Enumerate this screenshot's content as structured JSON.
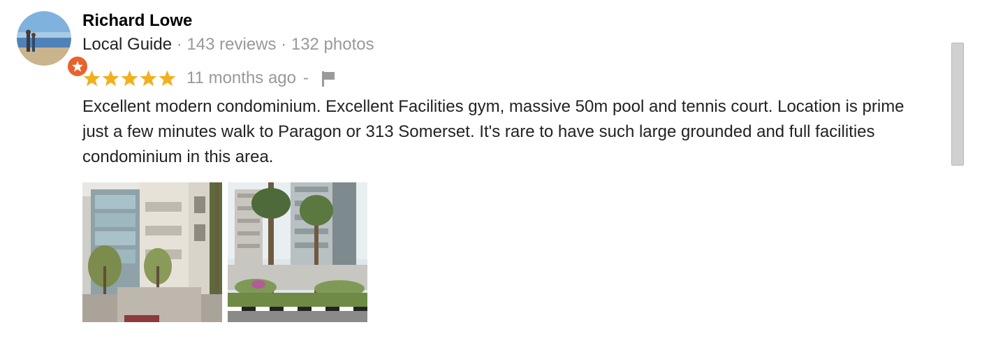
{
  "review": {
    "author": {
      "name": "Richard Lowe",
      "badge": "Local Guide",
      "separator": "·",
      "reviews_count": "143 reviews",
      "photos_count": "132 photos",
      "avatar_icon": "avatar-photo",
      "badge_icon": "local-guide-star-icon",
      "badge_color": "#e8622c"
    },
    "rating": 5,
    "max_rating": 5,
    "star_color": "#f2b01e",
    "time_ago": "11 months ago",
    "dash": "-",
    "flag_icon": "flag-icon",
    "text": "Excellent modern condominium. Excellent Facilities gym, massive 50m pool and tennis court. Location is prime just a few minutes walk to Paragon or 313 Somerset. It's rare to have such large grounded and full facilities condominium in this area.",
    "photos": [
      {
        "subject": "condominium-building-facade"
      },
      {
        "subject": "condominium-towers-with-palms"
      }
    ]
  }
}
